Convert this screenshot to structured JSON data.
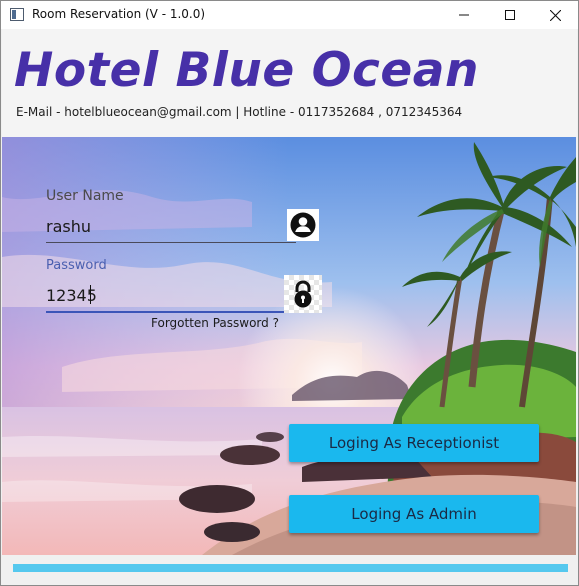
{
  "window": {
    "title": "Room Reservation (V - 1.0.0)",
    "controls": [
      "minimize-icon",
      "maximize-icon",
      "close-icon"
    ]
  },
  "header": {
    "hotel_name": "Hotel Blue Ocean",
    "contact": "E-Mail - hotelblueocean@gmail.com | Hotline - 0117352684 , 0712345364"
  },
  "login": {
    "username_label": "User Name",
    "username_value": "rashu",
    "username_icon": "user-icon",
    "password_label": "Password",
    "password_value": "12345",
    "password_icon": "lock-icon",
    "forgot_password": "Forgotten Password ?"
  },
  "actions": {
    "receptionist_label": "Loging As Receptionist",
    "admin_label": "Loging As Admin"
  },
  "progress": {
    "value": 1.0
  },
  "colors": {
    "title": "#4730a8",
    "button": "#1ab8ee",
    "progress": "#55c8ee",
    "password_accent": "#3b55b8"
  }
}
